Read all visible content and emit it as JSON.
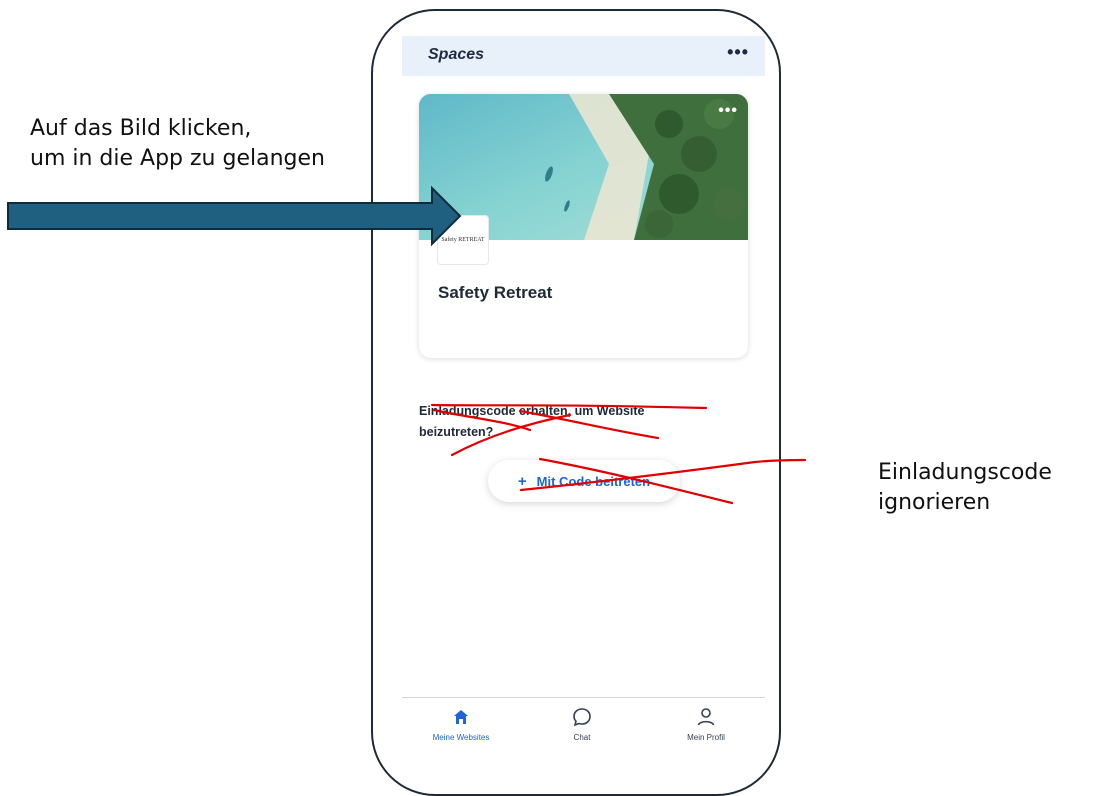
{
  "annotations": {
    "left_line1": "Auf das Bild klicken,",
    "left_line2": "um in die App zu gelangen",
    "right_line1": "Einladungscode",
    "right_line2": "ignorieren"
  },
  "app": {
    "header": {
      "title": "Spaces",
      "menu_icon": "more-horizontal-icon"
    },
    "card": {
      "menu_icon": "more-horizontal-icon",
      "logo_text": "Safety RETREAT",
      "title": "Safety Retreat"
    },
    "invite": {
      "text": "Einladungscode erhalten, um Website beizutreten?",
      "button_label": "Mit Code beitreten",
      "button_icon": "plus-icon"
    },
    "bottom_nav": {
      "items": [
        {
          "label": "Meine Websites",
          "icon": "home-icon",
          "active": true
        },
        {
          "label": "Chat",
          "icon": "chat-bubble-icon",
          "active": false
        },
        {
          "label": "Mein Profil",
          "icon": "user-icon",
          "active": false
        }
      ]
    }
  },
  "colors": {
    "accent": "#1f63d6",
    "arrow": "#1f5f80",
    "scribble": "#e00000",
    "header_bg": "#e8f0fa"
  }
}
